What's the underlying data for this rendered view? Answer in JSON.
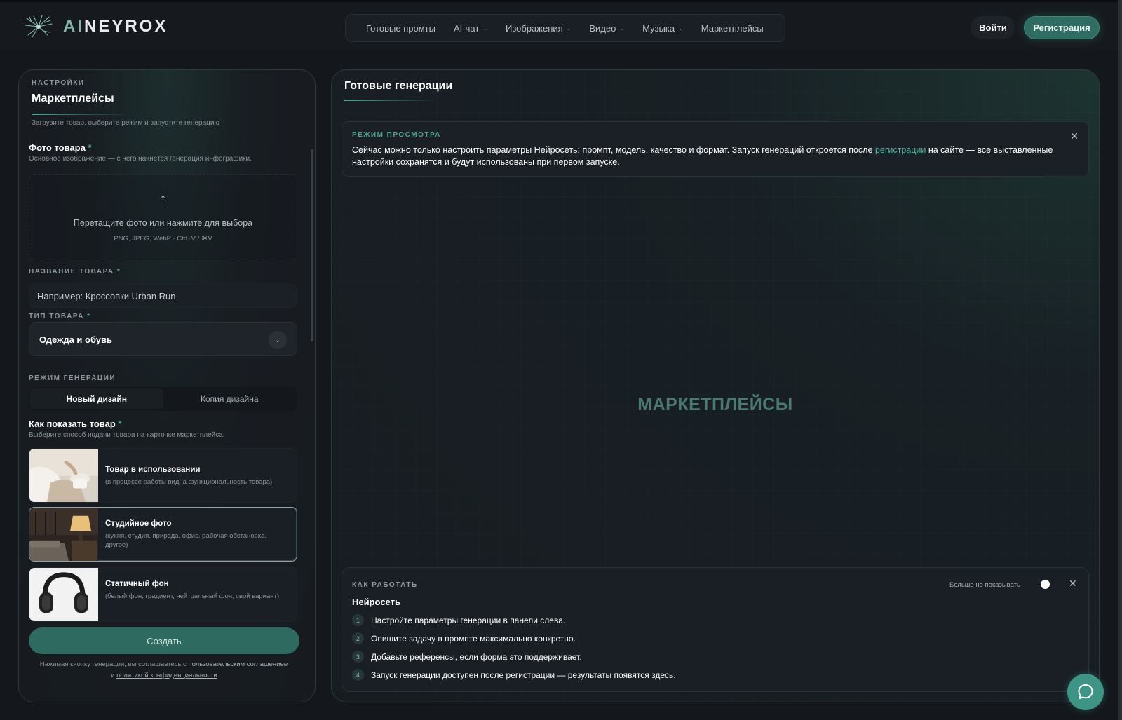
{
  "header": {
    "logo_prefix": "AI",
    "logo_suffix": "NEYROX",
    "nav": [
      {
        "label": "Готовые промты",
        "has_dropdown": false
      },
      {
        "label": "AI-чат",
        "has_dropdown": true
      },
      {
        "label": "Изображения",
        "has_dropdown": true
      },
      {
        "label": "Видео",
        "has_dropdown": true
      },
      {
        "label": "Музыка",
        "has_dropdown": true
      },
      {
        "label": "Маркетплейсы",
        "has_dropdown": false
      }
    ],
    "login_label": "Войти",
    "register_label": "Регистрация"
  },
  "settings": {
    "eyebrow": "НАСТРОЙКИ",
    "title": "Маркетплейсы",
    "description": "Загрузите товар, выберите режим и запустите генерацию",
    "photo": {
      "label": "Фото товара",
      "required_mark": "*",
      "hint": "Основное изображение — с него начнётся генерация инфографики.",
      "dropzone_text": "Перетащите фото или нажмите для выбора",
      "dropzone_formats": "PNG, JPEG, WebP · Ctrl+V / ⌘V"
    },
    "product_name": {
      "label": "НАЗВАНИЕ ТОВАРА",
      "required_mark": "*",
      "placeholder": "Например: Кроссовки Urban Run"
    },
    "product_type": {
      "label": "ТИП ТОВАРА",
      "required_mark": "*",
      "value": "Одежда и обувь"
    },
    "generation_mode": {
      "label": "РЕЖИМ ГЕНЕРАЦИИ",
      "options": [
        "Новый дизайн",
        "Копия дизайна"
      ],
      "selected": "Новый дизайн"
    },
    "presentation": {
      "label": "Как показать товар",
      "required_mark": "*",
      "hint": "Выберите способ подачи товара на карточке маркетплейса.",
      "options": [
        {
          "title": "Товар в использовании",
          "desc": "(в процессе работы видна функциональность товара)",
          "selected": false
        },
        {
          "title": "Студийное фото",
          "desc": "(кухня, студия, природа, офис, рабочая обстановка, другое)",
          "selected": true
        },
        {
          "title": "Статичный фон",
          "desc": "(белый фон, градиент, нейтральный фон, свой вариант)",
          "selected": false
        }
      ]
    },
    "create_label": "Создать",
    "legal_prefix": "Нажимая кнопку генерации, вы соглашаетесь с",
    "legal_link1": "пользовательским соглашением",
    "legal_and": "и",
    "legal_link2": "политикой конфиденциальности"
  },
  "results": {
    "title": "Готовые генерации",
    "notice": {
      "eyebrow": "РЕЖИМ ПРОСМОТРА",
      "text_before": "Сейчас можно только настроить параметры Нейросеть: промпт, модель, качество и формат. Запуск генераций откроется после",
      "link": "регистрации",
      "text_after": "на сайте — все выставленные настройки сохранятся и будут использованы при первом запуске."
    },
    "placeholder": "МАРКЕТПЛЕЙСЫ",
    "howto": {
      "eyebrow": "КАК РАБОТАТЬ",
      "title": "Нейросеть",
      "dont_show_label": "Больше не показывать",
      "steps": [
        {
          "num": "1",
          "text": "Настройте параметры генерации в панели слева."
        },
        {
          "num": "2",
          "text": "Опишите задачу в промпте максимально конкретно."
        },
        {
          "num": "3",
          "text": "Добавьте референсы, если форма это поддерживает."
        },
        {
          "num": "4",
          "text": "Запуск генерации доступен после регистрации — результаты появятся здесь."
        }
      ]
    }
  },
  "colors": {
    "accent": "#4fa595",
    "brand_button": "#2f6d62",
    "background": "#14181d"
  },
  "icons": [
    "logo-icon",
    "chevron-down-icon",
    "upload-arrow-icon",
    "close-icon",
    "chat-icon"
  ]
}
